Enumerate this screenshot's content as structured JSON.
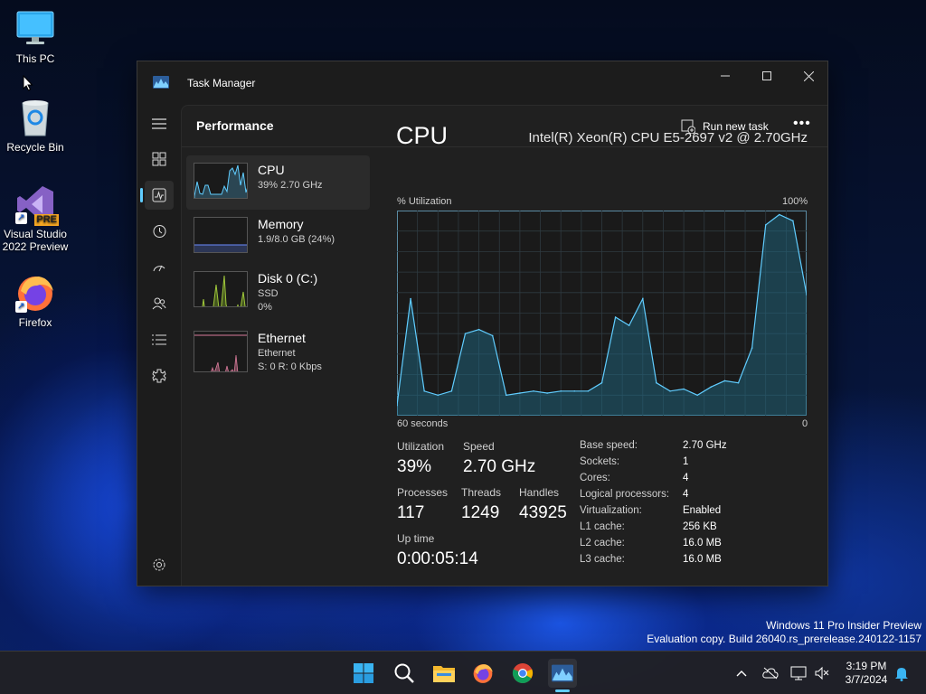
{
  "desktop": {
    "icons": [
      {
        "label": "This PC"
      },
      {
        "label": "Recycle Bin"
      },
      {
        "label": "Visual Studio 2022 Preview",
        "badge": "PRE"
      },
      {
        "label": "Firefox"
      }
    ],
    "watermark": {
      "line1": "Windows 11 Pro Insider Preview",
      "line2": "Evaluation copy. Build 26040.rs_prerelease.240122-1157"
    }
  },
  "window": {
    "title": "Task Manager",
    "controls": {
      "minimize": "─",
      "maximize": "☐",
      "close": "✕"
    },
    "sidebar": [
      {
        "icon": "hamburger-icon"
      },
      {
        "icon": "processes-icon"
      },
      {
        "icon": "performance-icon",
        "active": true
      },
      {
        "icon": "app-history-icon"
      },
      {
        "icon": "startup-apps-icon"
      },
      {
        "icon": "users-icon"
      },
      {
        "icon": "details-icon"
      },
      {
        "icon": "services-icon"
      },
      {
        "icon": "settings-icon"
      }
    ],
    "header": {
      "title": "Performance",
      "run_task": "Run new task",
      "more": "•••"
    },
    "list": [
      {
        "name": "CPU",
        "sub1": "39%  2.70 GHz",
        "sub2": ""
      },
      {
        "name": "Memory",
        "sub1": "1.9/8.0 GB (24%)",
        "sub2": ""
      },
      {
        "name": "Disk 0 (C:)",
        "sub1": "SSD",
        "sub2": "0%"
      },
      {
        "name": "Ethernet",
        "sub1": "Ethernet",
        "sub2": "S: 0  R: 0 Kbps"
      }
    ],
    "detail": {
      "title": "CPU",
      "model": "Intel(R) Xeon(R) CPU E5-2697 v2 @ 2.70GHz",
      "graph_label": "% Utilization",
      "graph_max": "100%",
      "graph_time": "60 seconds",
      "graph_min": "0",
      "accent": "#60cdff",
      "stats": {
        "utilization_label": "Utilization",
        "utilization": "39%",
        "speed_label": "Speed",
        "speed": "2.70 GHz",
        "processes_label": "Processes",
        "processes": "117",
        "threads_label": "Threads",
        "threads": "1249",
        "handles_label": "Handles",
        "handles": "43925",
        "uptime_label": "Up time",
        "uptime": "0:00:05:14"
      },
      "specs": [
        {
          "k": "Base speed:",
          "v": "2.70 GHz"
        },
        {
          "k": "Sockets:",
          "v": "1"
        },
        {
          "k": "Cores:",
          "v": "4"
        },
        {
          "k": "Logical processors:",
          "v": "4"
        },
        {
          "k": "Virtualization:",
          "v": "Enabled"
        },
        {
          "k": "L1 cache:",
          "v": "256 KB"
        },
        {
          "k": "L2 cache:",
          "v": "16.0 MB"
        },
        {
          "k": "L3 cache:",
          "v": "16.0 MB"
        }
      ]
    }
  },
  "chart_data": {
    "type": "area",
    "title": "",
    "xlabel": "60 seconds",
    "ylabel": "% Utilization",
    "ylim": [
      0,
      100
    ],
    "x": [
      60,
      58,
      56,
      54,
      52,
      50,
      48,
      46,
      44,
      42,
      40,
      38,
      36,
      34,
      32,
      30,
      28,
      26,
      24,
      22,
      20,
      18,
      16,
      14,
      12,
      10,
      8,
      6,
      4,
      2,
      0
    ],
    "series": [
      {
        "values": [
          5,
          57,
          12,
          10,
          12,
          40,
          42,
          39,
          10,
          11,
          12,
          11,
          12,
          12,
          12,
          16,
          48,
          44,
          57,
          16,
          12,
          13,
          10,
          14,
          17,
          16,
          33,
          93,
          98,
          95,
          59
        ]
      }
    ]
  },
  "taskbar": {
    "apps": [
      "start-icon",
      "search-icon",
      "file-explorer-icon",
      "firefox-icon",
      "chrome-icon",
      "task-manager-icon"
    ],
    "time": "3:19 PM",
    "date": "3/7/2024"
  }
}
